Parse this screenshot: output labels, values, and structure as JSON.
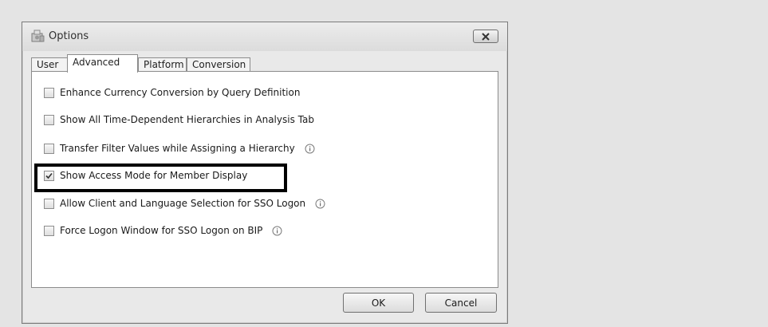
{
  "window": {
    "title": "Options"
  },
  "tabs": [
    {
      "label": "User",
      "active": false
    },
    {
      "label": "Advanced",
      "active": true
    },
    {
      "label": "Platform",
      "active": false
    },
    {
      "label": "Conversion",
      "active": false
    }
  ],
  "options": [
    {
      "label": "Enhance Currency Conversion by Query Definition",
      "checked": false,
      "info": false
    },
    {
      "label": "Show All Time-Dependent Hierarchies in Analysis Tab",
      "checked": false,
      "info": false
    },
    {
      "label": "Transfer Filter Values while Assigning a Hierarchy",
      "checked": false,
      "info": true
    },
    {
      "label": "Show Access Mode for Member Display",
      "checked": true,
      "info": false,
      "highlighted": true
    },
    {
      "label": "Allow Client and Language Selection for SSO Logon",
      "checked": false,
      "info": true
    },
    {
      "label": "Force Logon Window for SSO Logon on BIP",
      "checked": false,
      "info": true
    }
  ],
  "buttons": {
    "ok_label": "OK",
    "cancel_label": "Cancel"
  },
  "icons": {
    "title": "options-window-icon",
    "close": "close-icon",
    "check": "checkmark-icon",
    "info": "info-icon"
  },
  "colors": {
    "highlight_border": "#000000",
    "background": "#e4e4e4"
  }
}
